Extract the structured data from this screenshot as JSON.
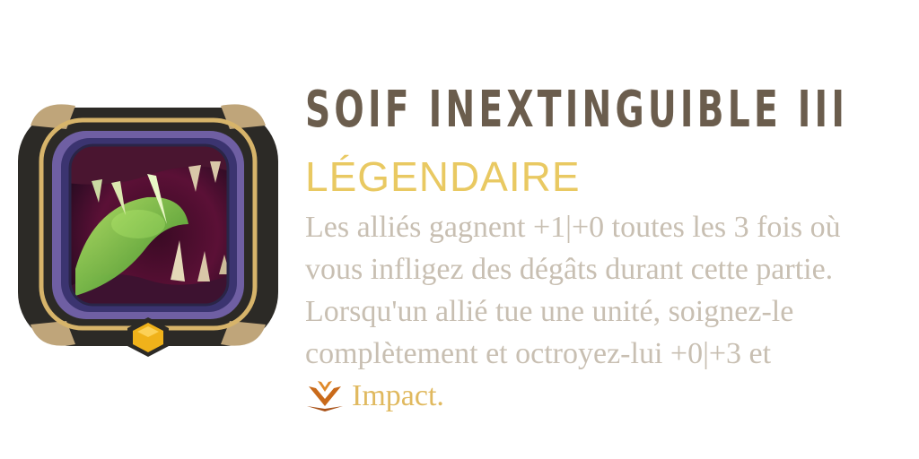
{
  "card": {
    "title": "SOIF INEXTINGUIBLE III",
    "rarity": "LÉGENDAIRE",
    "description_lines": [
      "Les alliés gagnent +1|+0 toutes les 3 fois où",
      "vous infligez des dégâts durant cette partie.",
      "Lorsqu'un allié tue une unité, soignez-le",
      "complètement et octroyez-lui +0|+3 et"
    ],
    "keyword": {
      "icon": "impact-icon",
      "label": "Impact."
    }
  },
  "colors": {
    "title": "#6b5d4d",
    "rarity": "#e9c962",
    "description": "#c8bfb2",
    "keyword": "#e0b95f",
    "frame_gold": "#d7b46a",
    "frame_dark": "#2c2a26",
    "frame_purple": "#6f5fa3",
    "gem": "#f0b21a"
  }
}
